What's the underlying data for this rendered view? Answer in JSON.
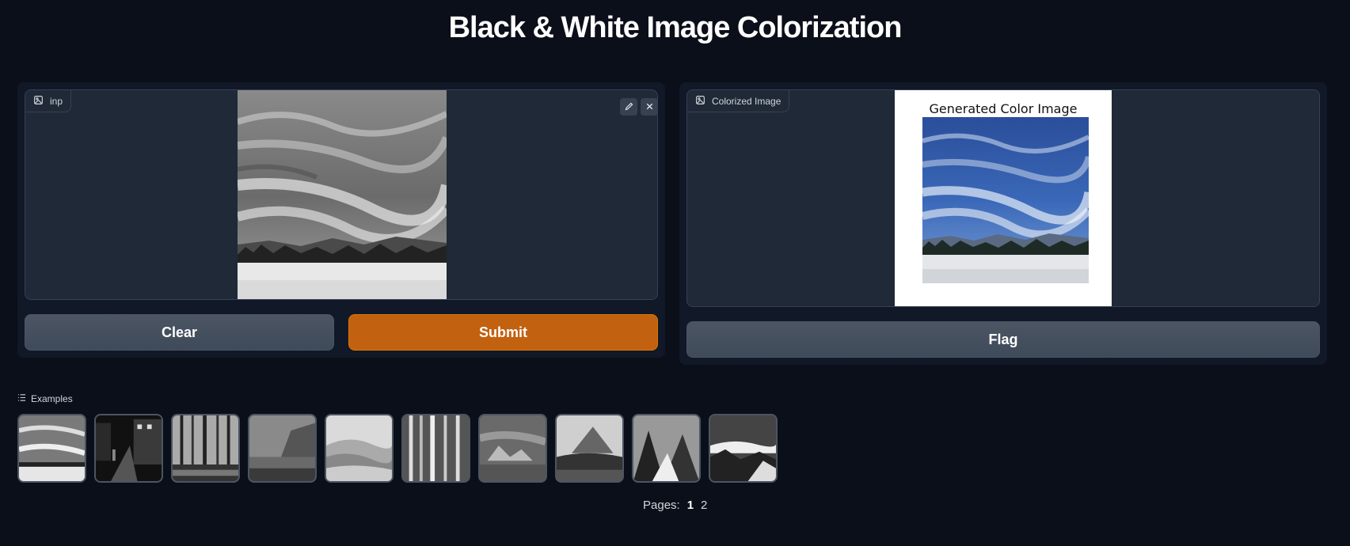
{
  "header": {
    "title": "Black & White Image Colorization"
  },
  "input_panel": {
    "label": "inp",
    "label_icon": "image-icon",
    "edit_icon": "pencil-icon",
    "close_icon": "close-icon",
    "clear_label": "Clear",
    "submit_label": "Submit"
  },
  "output_panel": {
    "label": "Colorized Image",
    "label_icon": "image-icon",
    "image_caption": "Generated Color Image",
    "flag_label": "Flag"
  },
  "examples": {
    "label": "Examples",
    "icon": "list-icon",
    "items": [
      "sky-clouds-field",
      "city-street-night",
      "forest-stream",
      "coastal-cliff",
      "misty-hills",
      "birch-forest",
      "rocky-terrain",
      "mountain-peak",
      "snowy-ridge",
      "snowy-mountains"
    ]
  },
  "pagination": {
    "label": "Pages:",
    "pages": [
      "1",
      "2"
    ],
    "current": "1"
  },
  "colors": {
    "background": "#0b0f19",
    "panel": "#111827",
    "primary": "#c2610f",
    "secondary": "#4b5563"
  }
}
